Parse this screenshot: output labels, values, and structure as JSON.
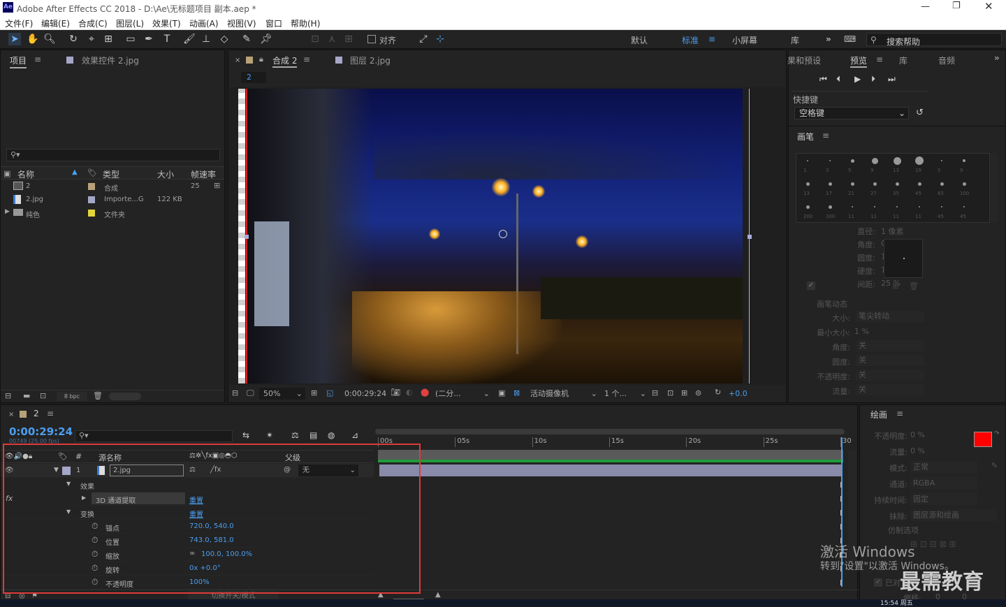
{
  "app": {
    "title": "Adobe After Effects CC 2018 - D:\\Ae\\无标题项目 副本.aep *",
    "logo": "Ae"
  },
  "menu": [
    "文件(F)",
    "编辑(E)",
    "合成(C)",
    "图层(L)",
    "效果(T)",
    "动画(A)",
    "视图(V)",
    "窗口",
    "帮助(H)"
  ],
  "toolbar": {
    "snap_label": "对齐",
    "workspaces": [
      "默认",
      "标准",
      "小屏幕",
      "库"
    ],
    "search_placeholder": "搜索帮助"
  },
  "project": {
    "tab_project": "项目",
    "tab_effects": "效果控件 2.jpg",
    "search_placeholder": "",
    "columns": [
      "名称",
      "类型",
      "大小",
      "帧速率"
    ],
    "items": [
      {
        "name": "2",
        "type": "合成",
        "size": "",
        "fps": "25",
        "color": "#b8a179"
      },
      {
        "name": "2.jpg",
        "type": "Importe...G",
        "size": "122 KB",
        "fps": "",
        "color": "#a6a6c8"
      },
      {
        "name": "纯色",
        "type": "文件夹",
        "size": "",
        "fps": "",
        "color": "#e3d43c"
      }
    ],
    "bpc": "8 bpc"
  },
  "comp": {
    "tab_comp": "合成 2",
    "tab_layer": "图层 2.jpg",
    "flow_label": "2",
    "zoom": "50%",
    "time": "0:00:29:24",
    "resolution": "(二分...",
    "camera": "活动摄像机",
    "views": "1 个...",
    "exposure": "+0.0"
  },
  "preview": {
    "tabs": [
      "果和预设",
      "预览",
      "库",
      "音频"
    ],
    "shortcut_label": "快捷键",
    "shortcut_value": "空格键"
  },
  "brush": {
    "title": "画笔",
    "sizes": [
      "1",
      "3",
      "5",
      "9",
      "13",
      "19",
      "5",
      "9",
      "13",
      "17",
      "21",
      "27",
      "35",
      "45",
      "65",
      "100",
      "200",
      "300",
      "11",
      "11",
      "11",
      "11",
      "45",
      "45"
    ],
    "props": [
      {
        "label": "直径:",
        "value": "1 像素"
      },
      {
        "label": "角度:",
        "value": "0 °"
      },
      {
        "label": "圆度:",
        "value": "100 %"
      },
      {
        "label": "硬度:",
        "value": "100 %"
      },
      {
        "label": "间距:",
        "value": "25 %"
      }
    ],
    "dynamics": "画笔动态",
    "dyn_rows": [
      {
        "label": "大小:",
        "value": "笔尖转动"
      },
      {
        "label": "最小大小:",
        "value": "1 %"
      },
      {
        "label": "角度:",
        "value": "关"
      },
      {
        "label": "圆度:",
        "value": "关"
      },
      {
        "label": "不透明度:",
        "value": "关"
      },
      {
        "label": "流量:",
        "value": "关"
      }
    ]
  },
  "paint": {
    "title": "绘画",
    "rows": [
      {
        "label": "不透明度:",
        "value": "0 %"
      },
      {
        "label": "流量:",
        "value": "0 %"
      },
      {
        "label": "模式:",
        "value": "正常"
      },
      {
        "label": "通道:",
        "value": "RGBA"
      },
      {
        "label": "持续时间:",
        "value": "固定"
      },
      {
        "label": "抹除:",
        "value": "图层源和绘画"
      }
    ],
    "clone": "仿制选项",
    "offset_label": "偏移:",
    "offset_x": "0",
    "offset_y": "0",
    "foreground": "#ff0000",
    "background": "#ffffff",
    "locked": "已对"
  },
  "timeline": {
    "tab": "2",
    "time": "0:00:29:24",
    "frames": "00749 (25.00 fps)",
    "col_source": "源名称",
    "col_parent": "父级",
    "layer_num": "1",
    "layer_name": "2.jpg",
    "parent_value": "无",
    "rows": [
      {
        "kind": "group",
        "label": "效果",
        "value": ""
      },
      {
        "kind": "effect",
        "label": "3D 通道提取",
        "value": "重置"
      },
      {
        "kind": "group",
        "label": "变换",
        "value": "重置"
      },
      {
        "kind": "prop",
        "label": "锚点",
        "value": "720.0, 540.0"
      },
      {
        "kind": "prop",
        "label": "位置",
        "value": "743.0, 581.0"
      },
      {
        "kind": "prop",
        "label": "缩放",
        "value": "100.0, 100.0%"
      },
      {
        "kind": "prop",
        "label": "旋转",
        "value": "0x +0.0°"
      },
      {
        "kind": "prop",
        "label": "不透明度",
        "value": "100%"
      }
    ],
    "ruler": [
      "00s",
      "05s",
      "10s",
      "15s",
      "20s",
      "25s",
      "30"
    ],
    "switch_modes": "切换开关/模式"
  },
  "watermark": {
    "line1": "激活 Windows",
    "line2": "转到\"设置\"以激活 Windows。",
    "brand": "最需教育"
  },
  "clock": "15:54 周五"
}
